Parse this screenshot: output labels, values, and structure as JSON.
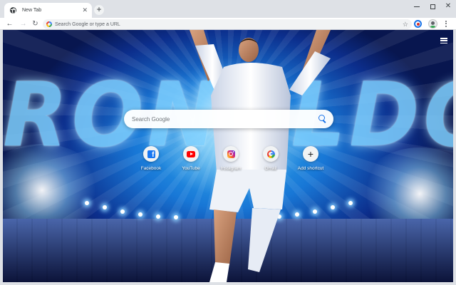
{
  "browser": {
    "tab": {
      "title": "New Tab",
      "close_glyph": "✕",
      "favicon": "globe-icon"
    },
    "new_tab_glyph": "+",
    "window_controls": {
      "close_glyph": "✕"
    },
    "nav": {
      "back_glyph": "←",
      "forward_glyph": "→",
      "reload_glyph": "↻"
    },
    "omnibox": {
      "placeholder": "Search Google or type a URL",
      "star_glyph": "☆"
    }
  },
  "page": {
    "background_text": "RONALDO",
    "colors": {
      "accent_blue": "#1a73e8",
      "background_glow": "#38b6f2",
      "background_deep": "#0c2e8c"
    },
    "search": {
      "placeholder": "Search Google"
    },
    "shortcuts": [
      {
        "label": "Facebook",
        "icon": "facebook-icon"
      },
      {
        "label": "YouTube",
        "icon": "youtube-icon"
      },
      {
        "label": "Instagram",
        "icon": "instagram-icon"
      },
      {
        "label": "Gmail",
        "icon": "google-icon"
      },
      {
        "label": "Add shortcut",
        "icon": "plus-icon",
        "glyph": "+"
      }
    ]
  }
}
